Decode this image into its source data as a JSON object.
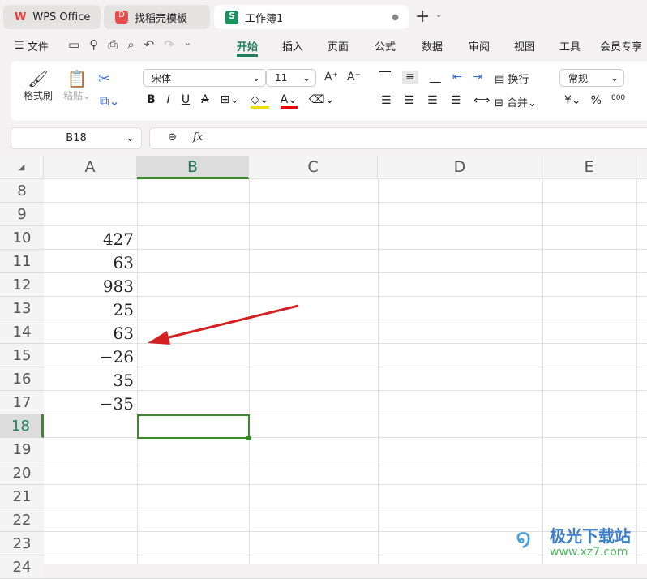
{
  "tabs": [
    {
      "label": "WPS Office"
    },
    {
      "label": "找稻壳模板"
    },
    {
      "label": "工作簿1"
    }
  ],
  "menu": {
    "file": "文件",
    "items": [
      "开始",
      "插入",
      "页面",
      "公式",
      "数据",
      "审阅",
      "视图",
      "工具",
      "会员专享"
    ]
  },
  "ribbon": {
    "format_painter": "格式刷",
    "paste": "粘贴",
    "font_name": "宋体",
    "font_size": "11",
    "wrap": "换行",
    "merge": "合并",
    "number_format": "常规",
    "currency": "¥",
    "percent": "%",
    "thousands": "000"
  },
  "formula_bar": {
    "cell_ref": "B18",
    "fx": "fx",
    "value": ""
  },
  "columns": [
    "A",
    "B",
    "C",
    "D",
    "E"
  ],
  "rows": [
    "8",
    "9",
    "10",
    "11",
    "12",
    "13",
    "14",
    "15",
    "16",
    "17",
    "18",
    "19",
    "20",
    "21",
    "22",
    "23",
    "24"
  ],
  "cells_a": [
    "",
    "",
    "427",
    "63",
    "983",
    "25",
    "63",
    "−26",
    "35",
    "−35",
    "",
    "",
    "",
    "",
    "",
    "",
    ""
  ],
  "watermark": {
    "name": "极光下载站",
    "url": "www.xz7.com"
  },
  "colors": {
    "accent": "#1e7f5c",
    "selection": "#3b8a2a",
    "arrow": "#d42020"
  }
}
